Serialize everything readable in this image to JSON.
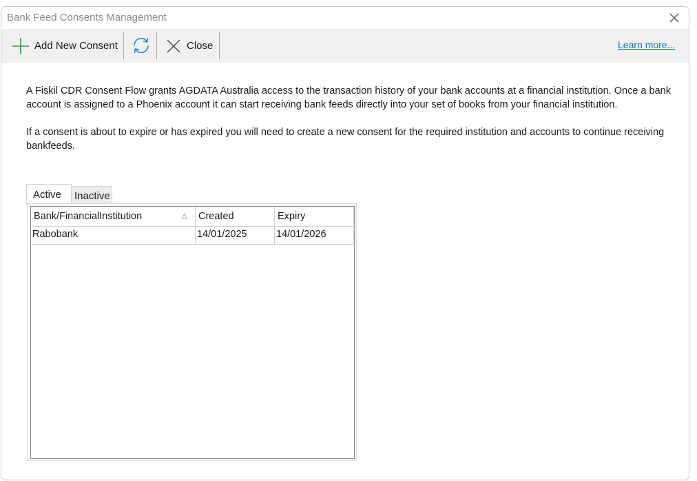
{
  "window": {
    "title": "Bank Feed Consents Management"
  },
  "toolbar": {
    "add_label": "Add New Consent",
    "close_label": "Close",
    "learn_more": "Learn more..."
  },
  "description": {
    "p1": "A Fiskil CDR Consent Flow grants AGDATA Australia access to the transaction history of your bank accounts at a financial institution. Once a bank account is assigned to a Phoenix account it can start receiving bank feeds directly into your set of books from your financial institution.",
    "p2": "If a consent is about to expire or has expired you will need to create a new consent for the required institution and accounts to continue receiving bankfeeds."
  },
  "tabs": [
    {
      "label": "Active"
    },
    {
      "label": "Inactive"
    }
  ],
  "grid": {
    "columns": [
      "Bank/FinancialInstitution",
      "Created",
      "Expiry"
    ],
    "sort_indicator": "△",
    "rows": [
      [
        "Rabobank",
        "14/01/2025",
        "14/01/2026"
      ]
    ]
  },
  "colors": {
    "accent_green": "#2e9e3e",
    "accent_blue": "#2f86d6",
    "link": "#1a6fc0"
  },
  "icons": {
    "add": "plus-icon",
    "refresh": "refresh-icon",
    "close": "close-icon"
  }
}
